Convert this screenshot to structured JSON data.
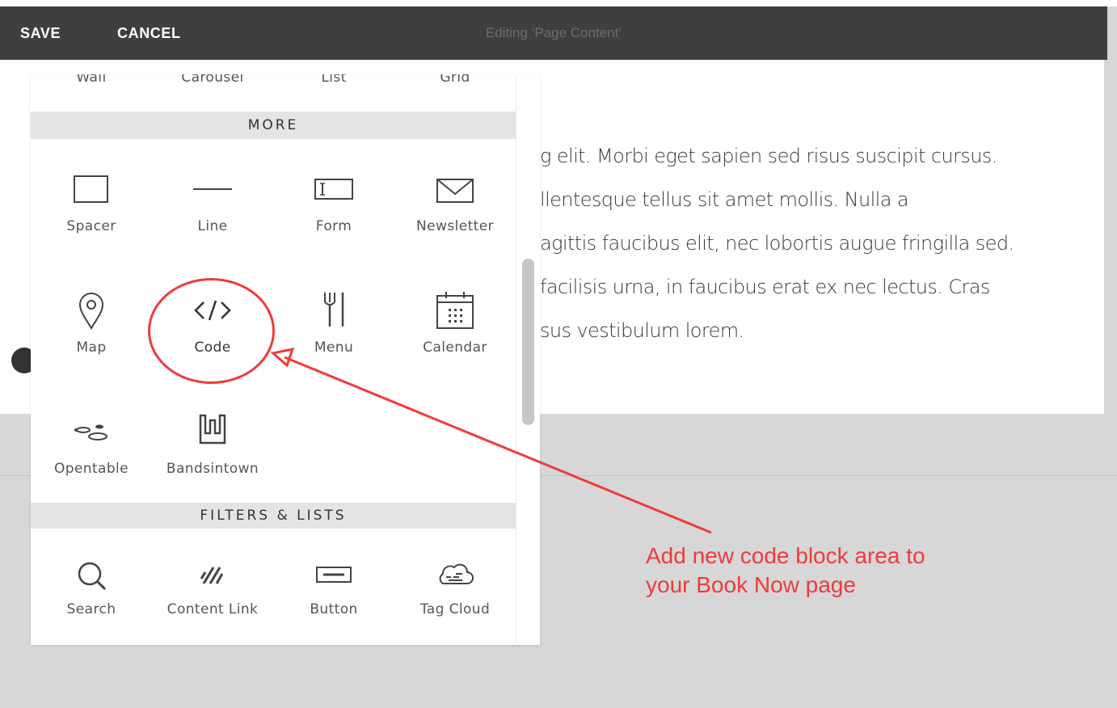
{
  "toolbar": {
    "save_label": "SAVE",
    "cancel_label": "CANCEL",
    "title": "Editing ‘Page Content’"
  },
  "content": {
    "lines": [
      "g elit. Morbi eget sapien sed risus suscipit cursus.",
      "llentesque tellus sit amet mollis. Nulla a",
      "agittis faucibus elit, nec lobortis augue fringilla sed.",
      "facilisis urna, in faucibus erat ex nec lectus. Cras",
      "sus vestibulum lorem."
    ]
  },
  "panel": {
    "top_row": [
      "Wall",
      "Carousel",
      "List",
      "Grid"
    ],
    "sections": {
      "more": {
        "title": "MORE",
        "items": [
          {
            "label": "Spacer",
            "icon": "spacer-icon"
          },
          {
            "label": "Line",
            "icon": "line-icon"
          },
          {
            "label": "Form",
            "icon": "form-icon"
          },
          {
            "label": "Newsletter",
            "icon": "newsletter-icon"
          },
          {
            "label": "Map",
            "icon": "map-pin-icon"
          },
          {
            "label": "Code",
            "icon": "code-icon"
          },
          {
            "label": "Menu",
            "icon": "fork-knife-icon"
          },
          {
            "label": "Calendar",
            "icon": "calendar-icon"
          },
          {
            "label": "Opentable",
            "icon": "opentable-icon"
          },
          {
            "label": "Bandsintown",
            "icon": "bandsintown-icon"
          }
        ]
      },
      "filters": {
        "title": "FILTERS & LISTS",
        "items": [
          {
            "label": "Search",
            "icon": "search-icon"
          },
          {
            "label": "Content Link",
            "icon": "content-link-icon"
          },
          {
            "label": "Button",
            "icon": "button-icon"
          },
          {
            "label": "Tag Cloud",
            "icon": "tag-cloud-icon"
          }
        ]
      }
    }
  },
  "annotation": {
    "lines": [
      "Add new code block area to",
      "your Book Now page"
    ],
    "color": "#ee3b3b"
  },
  "colors": {
    "toolbar_bg": "#3f3f3f",
    "page_bg": "#d7d7d7",
    "panel_bg": "#ffffff",
    "section_bg": "#e4e4e4"
  }
}
